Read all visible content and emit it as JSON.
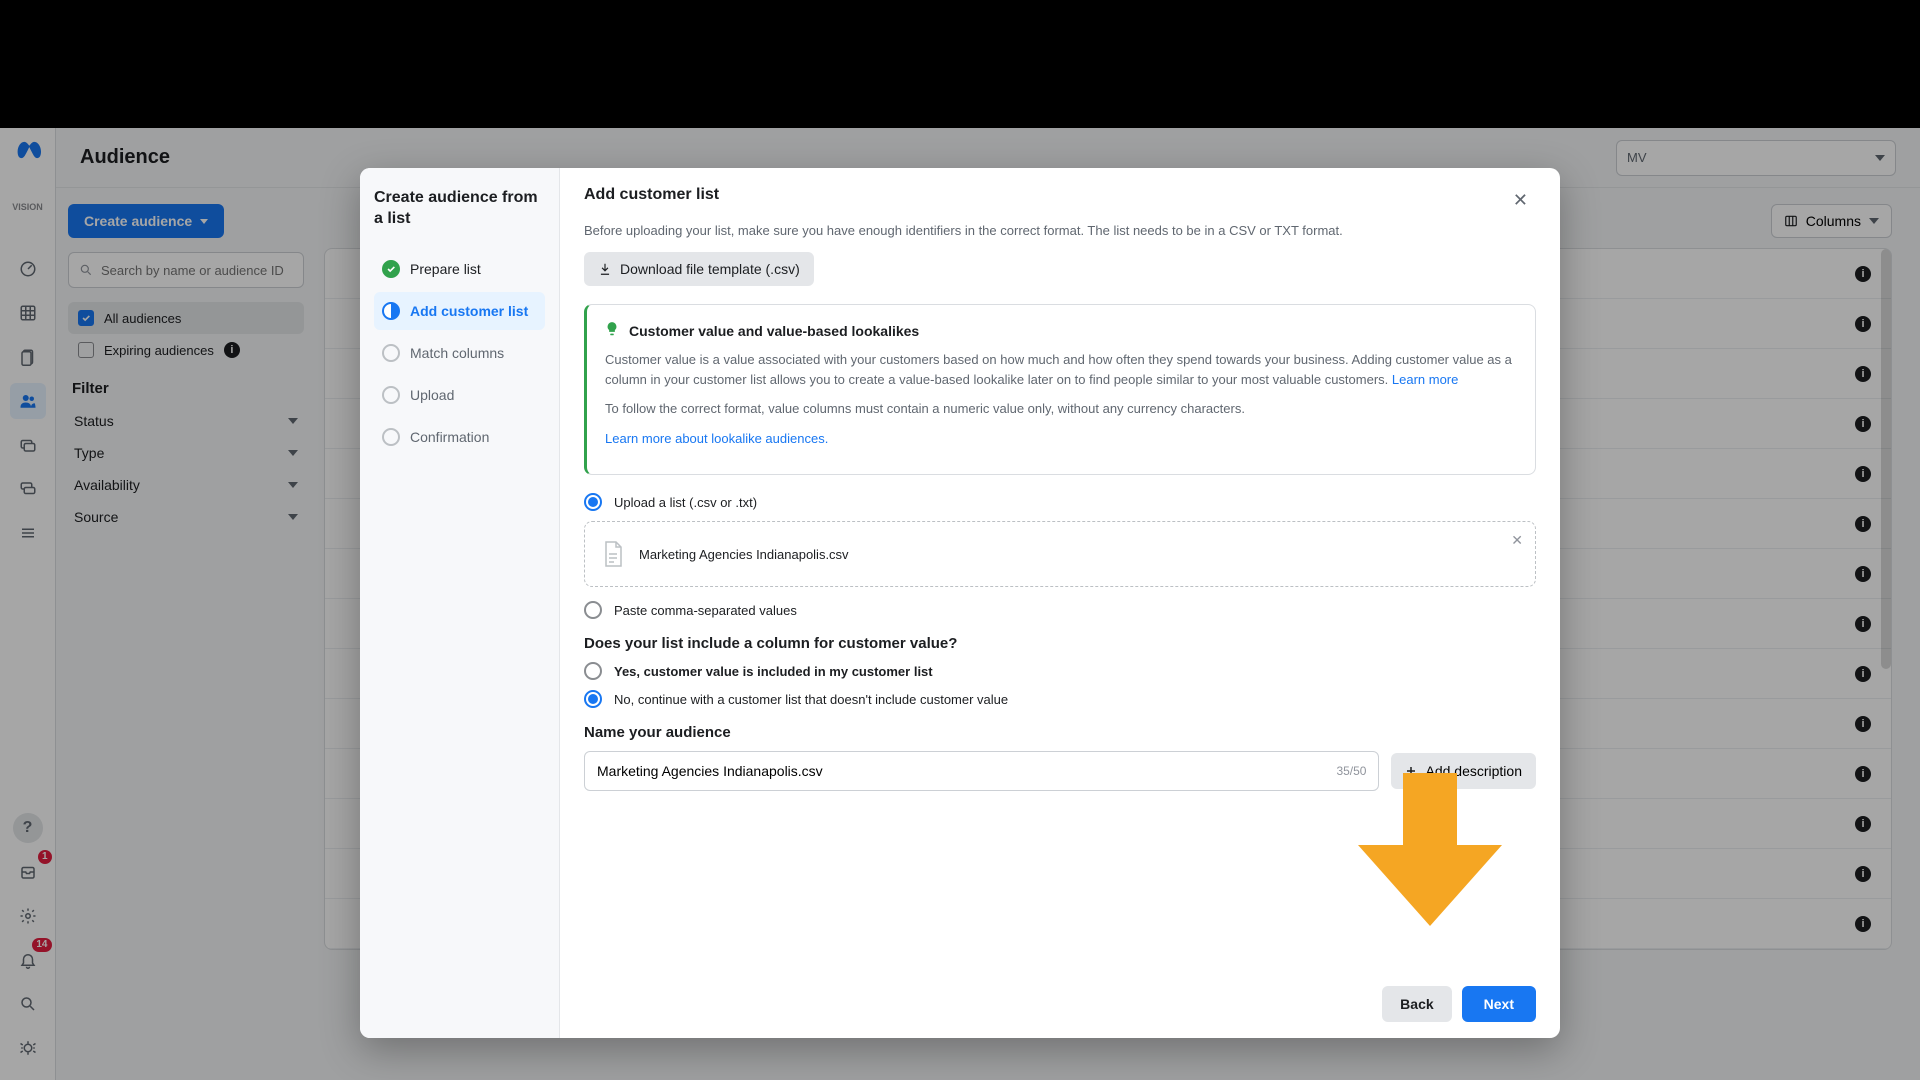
{
  "page": {
    "title": "Audience"
  },
  "account": {
    "label": "MV"
  },
  "toolbar": {
    "columns": "Columns"
  },
  "sidebar": {
    "create": "Create audience",
    "search_placeholder": "Search by name or audience ID",
    "all": "All audiences",
    "expiring": "Expiring audiences",
    "filter_title": "Filter",
    "filters": {
      "status": "Status",
      "type": "Type",
      "availability": "Availability",
      "source": "Source"
    }
  },
  "rail": {
    "help": "?",
    "badge_small": "1",
    "badge_large": "14"
  },
  "modal": {
    "wizard_title": "Create audience from a list",
    "steps": {
      "prepare": "Prepare list",
      "add": "Add customer list",
      "match": "Match columns",
      "upload": "Upload",
      "confirm": "Confirmation"
    },
    "header": "Add customer list",
    "subtext": "Before uploading your list, make sure you have enough identifiers in the correct format. The list needs to be in a CSV or TXT format.",
    "download_template": "Download file template (.csv)",
    "info": {
      "title": "Customer value and value-based lookalikes",
      "body1": "Customer value is a value associated with your customers based on how much and how often they spend towards your business. Adding customer value as a column in your customer list allows you to create a value-based lookalike later on to find people similar to your most valuable customers. ",
      "learn_more": "Learn more",
      "body2": "To follow the correct format, value columns must contain a numeric value only, without any currency characters.",
      "learn_lookalike": "Learn more about lookalike audiences."
    },
    "upload": {
      "opt_upload": "Upload a list (.csv or .txt)",
      "filename": "Marketing Agencies Indianapolis.csv",
      "opt_paste": "Paste comma-separated values"
    },
    "value_q": "Does your list include a column for customer value?",
    "value_yes": "Yes, customer value is included in my customer list",
    "value_no": "No, continue with a customer list that doesn't include customer value",
    "name_title": "Name your audience",
    "name_value": "Marketing Agencies Indianapolis.csv",
    "name_counter": "35/50",
    "add_desc": "Add description",
    "back": "Back",
    "next": "Next"
  }
}
